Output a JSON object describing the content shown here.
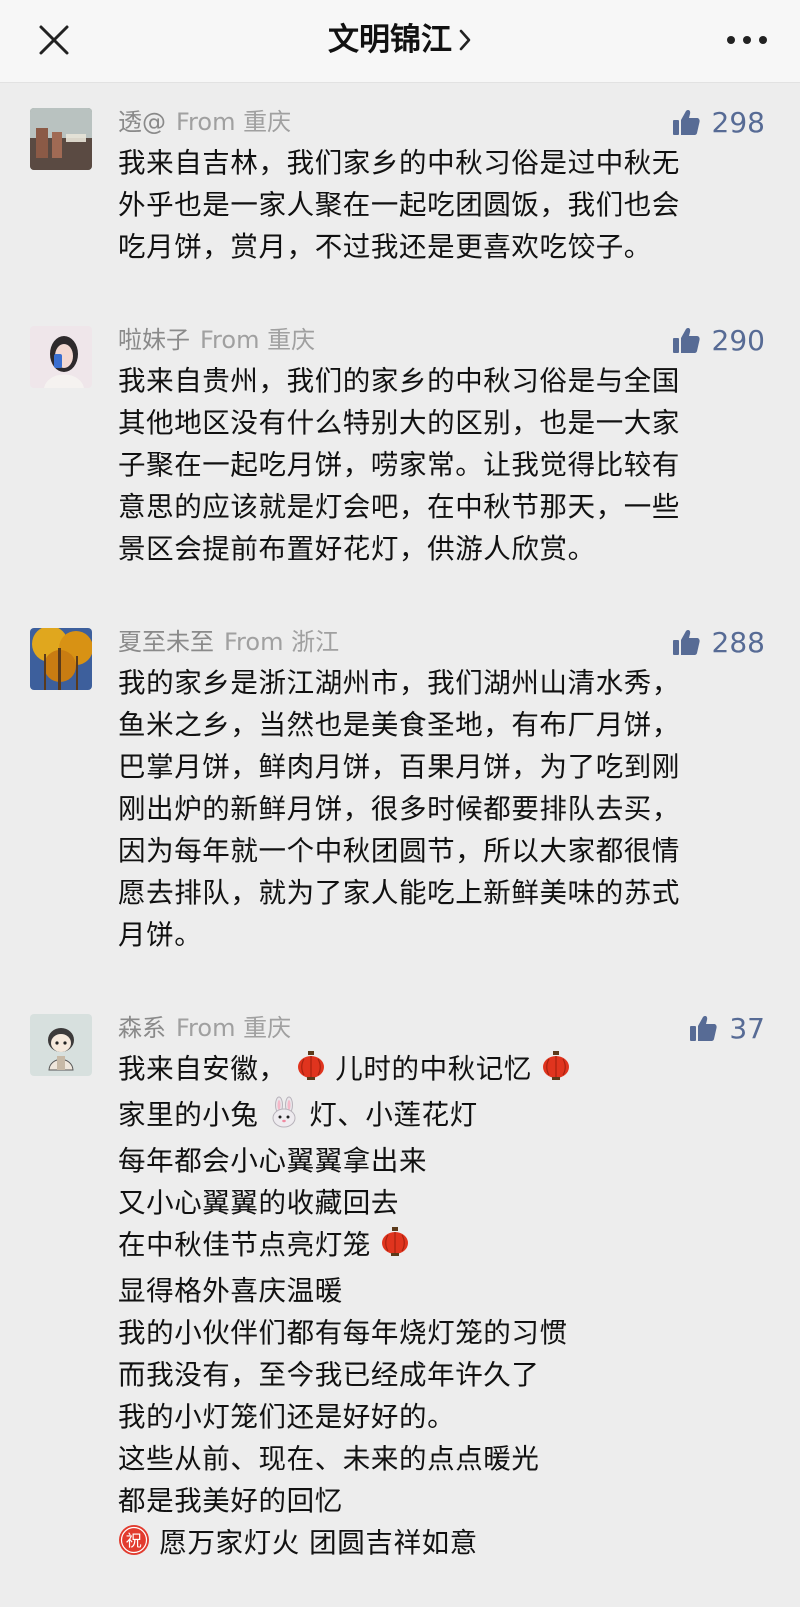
{
  "header": {
    "title": "文明锦江",
    "close_icon": "close-icon",
    "more_icon": "more-icon"
  },
  "comments": [
    {
      "name": "透@",
      "from": "From 重庆",
      "likes": "298",
      "lines": [
        "我来自吉林，我们家乡的中秋习俗是过中秋无",
        "外乎也是一家人聚在一起吃团圆饭，我们也会",
        "吃月饼，赏月，不过我还是更喜欢吃饺子。"
      ]
    },
    {
      "name": "啦妹子",
      "from": "From 重庆",
      "likes": "290",
      "lines": [
        "我来自贵州，我们的家乡的中秋习俗是与全国",
        "其他地区没有什么特别大的区别，也是一大家",
        "子聚在一起吃月饼，唠家常。让我觉得比较有",
        "意思的应该就是灯会吧，在中秋节那天，一些",
        "景区会提前布置好花灯，供游人欣赏。"
      ]
    },
    {
      "name": "夏至未至",
      "from": "From 浙江",
      "likes": "288",
      "lines": [
        "我的家乡是浙江湖州市，我们湖州山清水秀，",
        "鱼米之乡，当然也是美食圣地，有布厂月饼，",
        "巴掌月饼，鲜肉月饼，百果月饼，为了吃到刚",
        "刚出炉的新鲜月饼，很多时候都要排队去买，",
        "因为每年就一个中秋团圆节，所以大家都很情",
        "愿去排队，就为了家人能吃上新鲜美味的苏式",
        "月饼。"
      ]
    },
    {
      "name": "森系",
      "from": "From 重庆",
      "likes": "37",
      "lines": [
        "我来自安徽，",
        "儿时的中秋记忆",
        "家里的小兔",
        "灯、小莲花灯",
        "每年都会小心翼翼拿出来",
        "又小心翼翼的收藏回去",
        "在中秋佳节点亮灯笼",
        "显得格外喜庆温暖",
        "我的小伙伴们都有每年烧灯笼的习惯",
        "而我没有，至今我已经成年许久了",
        "我的小灯笼们还是好好的。",
        "这些从前、现在、未来的点点暖光",
        "都是我美好的回忆",
        "愿万家灯火 团圆吉祥如意"
      ],
      "blessing_badge": "祝"
    }
  ],
  "icons": {
    "like": "thumbs-up-icon",
    "lantern": "lantern-emoji-icon",
    "rabbit": "rabbit-emoji-icon",
    "blessing": "blessing-badge-icon"
  },
  "colors": {
    "accent": "#576b95",
    "meta": "#8a8a8a",
    "background": "#ededed"
  }
}
